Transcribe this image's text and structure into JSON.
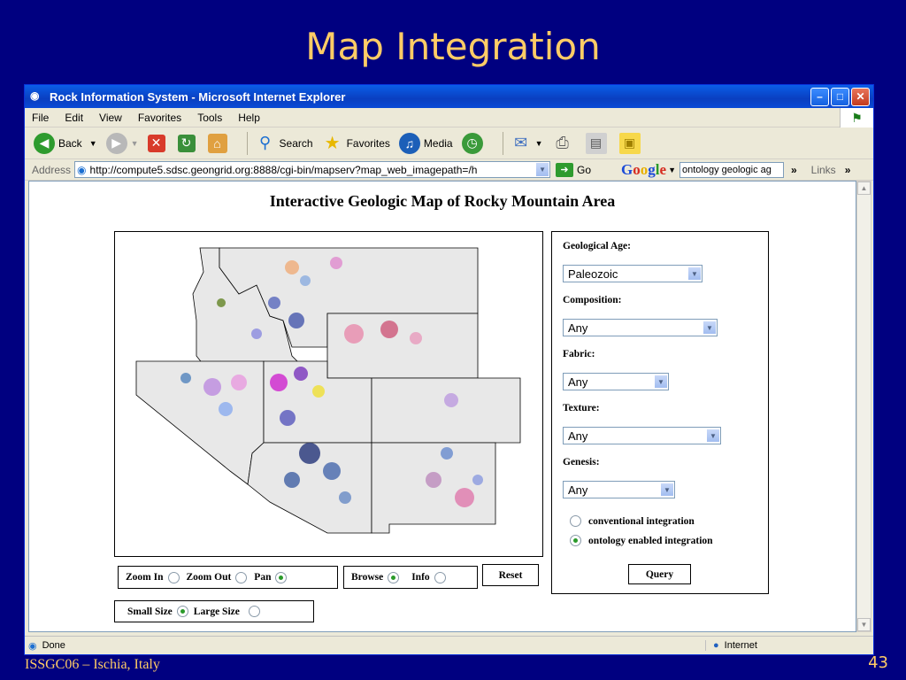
{
  "slide": {
    "title": "Map Integration",
    "footer_left": "ISSGC06 – Ischia, Italy",
    "page_number": "43"
  },
  "window": {
    "title": "Rock Information System - Microsoft Internet Explorer",
    "menus": [
      "File",
      "Edit",
      "View",
      "Favorites",
      "Tools",
      "Help"
    ],
    "toolbar": {
      "back": "Back",
      "search": "Search",
      "favorites": "Favorites",
      "media": "Media"
    },
    "address_label": "Address",
    "url": "http://compute5.sdsc.geongrid.org:8888/cgi-bin/mapserv?map_web_imagepath=/h",
    "go": "Go",
    "google_search_text": "ontology geologic ag",
    "links": "Links",
    "status_text": "Done",
    "zone": "Internet"
  },
  "page": {
    "heading": "Interactive Geologic Map of Rocky Mountain Area",
    "map_controls": {
      "zoom_in": "Zoom In",
      "zoom_out": "Zoom Out",
      "pan": "Pan",
      "browse": "Browse",
      "info": "Info",
      "reset": "Reset",
      "small_size": "Small Size",
      "large_size": "Large Size",
      "selected_tool": "pan",
      "selected_mode": "browse",
      "selected_size": "small"
    },
    "form": {
      "geological_age_label": "Geological Age:",
      "geological_age_value": "Paleozoic",
      "composition_label": "Composition:",
      "composition_value": "Any",
      "fabric_label": "Fabric:",
      "fabric_value": "Any",
      "texture_label": "Texture:",
      "texture_value": "Any",
      "genesis_label": "Genesis:",
      "genesis_value": "Any",
      "option_conventional": "conventional integration",
      "option_ontology": "ontology enabled integration",
      "selected_option": "ontology",
      "query": "Query"
    }
  },
  "colors": {
    "slide_bg": "#000080",
    "slide_text": "#ffcc66",
    "map_land": "#e8e8e8"
  }
}
